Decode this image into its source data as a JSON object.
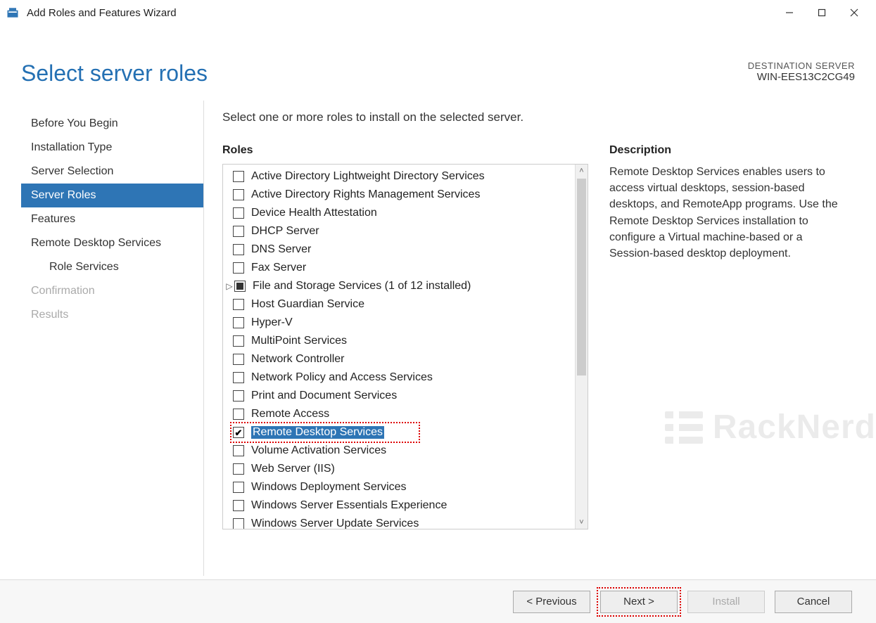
{
  "window": {
    "title": "Add Roles and Features Wizard"
  },
  "header": {
    "page_title": "Select server roles",
    "destination_label": "DESTINATION SERVER",
    "destination_value": "WIN-EES13C2CG49"
  },
  "sidebar": {
    "items": [
      {
        "label": "Before You Begin",
        "state": "normal"
      },
      {
        "label": "Installation Type",
        "state": "normal"
      },
      {
        "label": "Server Selection",
        "state": "normal"
      },
      {
        "label": "Server Roles",
        "state": "active"
      },
      {
        "label": "Features",
        "state": "normal"
      },
      {
        "label": "Remote Desktop Services",
        "state": "normal"
      },
      {
        "label": "Role Services",
        "state": "normal",
        "indent": true
      },
      {
        "label": "Confirmation",
        "state": "disabled"
      },
      {
        "label": "Results",
        "state": "disabled"
      }
    ]
  },
  "content": {
    "instruction": "Select one or more roles to install on the selected server.",
    "roles_heading": "Roles",
    "description_heading": "Description",
    "description_text": "Remote Desktop Services enables users to access virtual desktops, session-based desktops, and RemoteApp programs. Use the Remote Desktop Services installation to configure a Virtual machine-based or a Session-based desktop deployment.",
    "roles": [
      {
        "label": "Active Directory Lightweight Directory Services",
        "check": "unchecked"
      },
      {
        "label": "Active Directory Rights Management Services",
        "check": "unchecked"
      },
      {
        "label": "Device Health Attestation",
        "check": "unchecked"
      },
      {
        "label": "DHCP Server",
        "check": "unchecked"
      },
      {
        "label": "DNS Server",
        "check": "unchecked"
      },
      {
        "label": "Fax Server",
        "check": "unchecked"
      },
      {
        "label": "File and Storage Services (1 of 12 installed)",
        "check": "partial",
        "expandable": true
      },
      {
        "label": "Host Guardian Service",
        "check": "unchecked"
      },
      {
        "label": "Hyper-V",
        "check": "unchecked"
      },
      {
        "label": "MultiPoint Services",
        "check": "unchecked"
      },
      {
        "label": "Network Controller",
        "check": "unchecked"
      },
      {
        "label": "Network Policy and Access Services",
        "check": "unchecked"
      },
      {
        "label": "Print and Document Services",
        "check": "unchecked"
      },
      {
        "label": "Remote Access",
        "check": "unchecked"
      },
      {
        "label": "Remote Desktop Services",
        "check": "checked",
        "selected": true,
        "highlight": true
      },
      {
        "label": "Volume Activation Services",
        "check": "unchecked"
      },
      {
        "label": "Web Server (IIS)",
        "check": "unchecked"
      },
      {
        "label": "Windows Deployment Services",
        "check": "unchecked"
      },
      {
        "label": "Windows Server Essentials Experience",
        "check": "unchecked"
      },
      {
        "label": "Windows Server Update Services",
        "check": "unchecked"
      }
    ]
  },
  "footer": {
    "previous": "< Previous",
    "next": "Next >",
    "install": "Install",
    "cancel": "Cancel"
  },
  "watermark": "RackNerd"
}
